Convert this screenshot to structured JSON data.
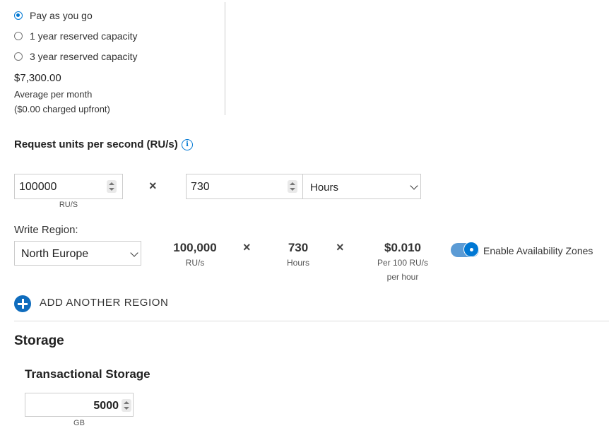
{
  "pricing": {
    "options": [
      {
        "label": "Pay as you go",
        "selected": true
      },
      {
        "label": "1 year reserved capacity",
        "selected": false
      },
      {
        "label": "3 year reserved capacity",
        "selected": false
      }
    ],
    "price": "$7,300.00",
    "average_label": "Average per month",
    "upfront_label": "($0.00 charged upfront)"
  },
  "request_units": {
    "title": "Request units per second (RU/s)",
    "info_icon": "info-icon",
    "ru_value": "100000",
    "ru_unit": "RU/S",
    "multiply": "×",
    "hours_value": "730",
    "hours_select": "Hours"
  },
  "region": {
    "label": "Write Region:",
    "selected": "North Europe",
    "ru_value": "100,000",
    "ru_unit": "RU/s",
    "hours_value": "730",
    "hours_unit": "Hours",
    "price": "$0.010",
    "price_unit_line1": "Per 100 RU/s",
    "price_unit_line2": "per hour",
    "availability_zones_label": "Enable Availability Zones",
    "availability_zones_enabled": true,
    "add_region_label": "ADD ANOTHER REGION"
  },
  "storage": {
    "title": "Storage",
    "transactional_title": "Transactional Storage",
    "value": "5000",
    "unit": "GB"
  },
  "colors": {
    "accent": "#0078d4",
    "toggle_track": "#5b9bd5"
  }
}
